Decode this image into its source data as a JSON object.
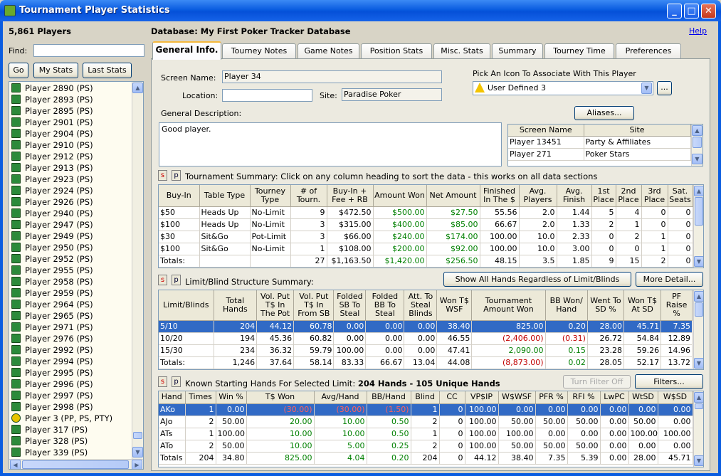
{
  "window": {
    "title": "Tournament Player Statistics"
  },
  "left": {
    "players_count": "5,861 Players",
    "find_label": "Find:",
    "find_value": "",
    "go_label": "Go",
    "mystats_label": "My Stats",
    "laststats_label": "Last Stats",
    "players": [
      "Player 2890 (PS)",
      "Player 2893 (PS)",
      "Player 2895 (PS)",
      "Player 2901 (PS)",
      "Player 2904 (PS)",
      "Player 2910 (PS)",
      "Player 2912 (PS)",
      "Player 2913 (PS)",
      "Player 2923 (PS)",
      "Player 2924 (PS)",
      "Player 2926 (PS)",
      "Player 2940 (PS)",
      "Player 2947 (PS)",
      "Player 2949 (PS)",
      "Player 2950 (PS)",
      "Player 2952 (PS)",
      "Player 2955 (PS)",
      "Player 2958 (PS)",
      "Player 2959 (PS)",
      "Player 2964 (PS)",
      "Player 2965 (PS)",
      "Player 2971 (PS)",
      "Player 2976 (PS)",
      "Player 2992 (PS)",
      "Player 2994 (PS)",
      "Player 2995 (PS)",
      "Player 2996 (PS)",
      "Player 2997 (PS)",
      "Player 2998 (PS)",
      "Player 3 (PP, PS, PTY)",
      "Player 317 (PS)",
      "Player 328 (PS)",
      "Player 339 (PS)"
    ]
  },
  "main": {
    "database_label": "Database: My First Poker Tracker Database",
    "help_label": "Help",
    "tabs": [
      "General Info.",
      "Tourney Notes",
      "Game Notes",
      "Position Stats",
      "Misc. Stats",
      "Summary",
      "Tourney Time",
      "Preferences"
    ],
    "screen_name_label": "Screen Name:",
    "screen_name_value": "Player 34",
    "location_label": "Location:",
    "location_value": "",
    "site_label": "Site:",
    "site_value": "Paradise Poker",
    "icon_label": "Pick An Icon To Associate With This Player",
    "icon_value": "User Defined 3",
    "ellipsis_label": "...",
    "aliases_label": "Aliases...",
    "desc_label": "General Description:",
    "desc_value": "Good player.",
    "aliases_table": {
      "headers": [
        "Screen Name",
        "Site"
      ],
      "rows": [
        [
          "Player 13451",
          "Party & Affiliates"
        ],
        [
          "Player 271",
          "Poker Stars"
        ]
      ]
    },
    "tourney_summary": {
      "s_label": "s",
      "p_label": "p",
      "title": "Tournament Summary: Click on any column heading to sort the data - this works on all data sections",
      "headers": [
        "Buy-In",
        "Table Type",
        "Tourney Type",
        "# of Tourn.",
        "Buy-In + Fee + RB",
        "Amount Won",
        "Net Amount",
        "Finished In The $",
        "Avg. Players",
        "Avg. Finish",
        "1st Place",
        "2nd Place",
        "3rd Place",
        "Sat. Seats"
      ],
      "rows": [
        [
          "$50",
          "Heads Up",
          "No-Limit",
          "9",
          "$472.50",
          "$500.00",
          "$27.50",
          "55.56",
          "2.0",
          "1.44",
          "5",
          "4",
          "0",
          "0"
        ],
        [
          "$100",
          "Heads Up",
          "No-Limit",
          "3",
          "$315.00",
          "$400.00",
          "$85.00",
          "66.67",
          "2.0",
          "1.33",
          "2",
          "1",
          "0",
          "0"
        ],
        [
          "$30",
          "Sit&Go",
          "Pot-Limit",
          "3",
          "$66.00",
          "$240.00",
          "$174.00",
          "100.00",
          "10.0",
          "2.33",
          "0",
          "2",
          "1",
          "0"
        ],
        [
          "$100",
          "Sit&Go",
          "No-Limit",
          "1",
          "$108.00",
          "$200.00",
          "$92.00",
          "100.00",
          "10.0",
          "3.00",
          "0",
          "0",
          "1",
          "0"
        ],
        [
          "Totals:",
          "",
          "",
          "27",
          "$1,163.50",
          "$1,420.00",
          "$256.50",
          "48.15",
          "3.5",
          "1.85",
          "9",
          "15",
          "2",
          "0"
        ]
      ]
    },
    "limit_summary": {
      "s_label": "s",
      "p_label": "p",
      "title": "Limit/Blind Structure Summary:",
      "show_all_label": "Show All Hands Regardless of Limit/Blinds",
      "more_detail_label": "More Detail...",
      "headers": [
        "Limit/Blinds",
        "Total Hands",
        "Vol. Put T$ In The Pot",
        "Vol. Put T$ In From SB",
        "Folded SB To Steal",
        "Folded BB To Steal",
        "Att. To Steal Blinds",
        "Won T$ WSF",
        "Tournament Amount Won",
        "BB Won/ Hand",
        "Went To SD %",
        "Won T$ At SD",
        "PF Raise %"
      ],
      "rows": [
        [
          "5/10",
          "204",
          "44.12",
          "60.78",
          "0.00",
          "0.00",
          "0.00",
          "38.40",
          "825.00",
          "0.20",
          "28.00",
          "45.71",
          "7.35"
        ],
        [
          "10/20",
          "194",
          "45.36",
          "60.82",
          "0.00",
          "0.00",
          "0.00",
          "46.55",
          "(2,406.00)",
          "(0.31)",
          "26.72",
          "54.84",
          "12.89"
        ],
        [
          "15/30",
          "234",
          "36.32",
          "59.79",
          "100.00",
          "0.00",
          "0.00",
          "47.41",
          "2,090.00",
          "0.15",
          "23.28",
          "59.26",
          "14.96"
        ],
        [
          "Totals:",
          "1,246",
          "37.64",
          "58.14",
          "83.33",
          "66.67",
          "13.04",
          "44.08",
          "(8,873.00)",
          "0.02",
          "28.05",
          "52.17",
          "13.72"
        ]
      ]
    },
    "hands": {
      "s_label": "s",
      "p_label": "p",
      "title_prefix": "Known Starting Hands For Selected Limit: ",
      "title_bold": "204 Hands - 105 Unique Hands",
      "turn_filter_label": "Turn Filter Off",
      "filters_label": "Filters...",
      "headers": [
        "Hand",
        "Times",
        "Win %",
        "T$ Won",
        "Avg/Hand",
        "BB/Hand",
        "Blind",
        "CC",
        "VP$IP",
        "W$WSF",
        "PFR %",
        "RFI %",
        "LwPC",
        "WtSD",
        "W$SD"
      ],
      "rows": [
        [
          "AKo",
          "1",
          "0.00",
          "(30.00)",
          "(30.00)",
          "(1.50)",
          "1",
          "0",
          "100.00",
          "0.00",
          "0.00",
          "0.00",
          "0.00",
          "0.00",
          "0.00"
        ],
        [
          "AJo",
          "2",
          "50.00",
          "20.00",
          "10.00",
          "0.50",
          "2",
          "0",
          "100.00",
          "50.00",
          "50.00",
          "50.00",
          "0.00",
          "50.00",
          "0.00"
        ],
        [
          "ATs",
          "1",
          "100.00",
          "10.00",
          "10.00",
          "0.50",
          "1",
          "0",
          "100.00",
          "100.00",
          "0.00",
          "0.00",
          "0.00",
          "100.00",
          "100.00"
        ],
        [
          "ATo",
          "2",
          "50.00",
          "10.00",
          "5.00",
          "0.25",
          "2",
          "0",
          "100.00",
          "50.00",
          "50.00",
          "50.00",
          "0.00",
          "0.00",
          "0.00"
        ],
        [
          "Totals",
          "204",
          "34.80",
          "825.00",
          "4.04",
          "0.20",
          "204",
          "0",
          "44.12",
          "38.40",
          "7.35",
          "5.39",
          "0.00",
          "28.00",
          "45.71"
        ]
      ]
    }
  },
  "colors": {
    "selection": "#316ac5",
    "positive": "#008000",
    "negative": "#c00000",
    "titlebar": "#0a5ce0"
  }
}
